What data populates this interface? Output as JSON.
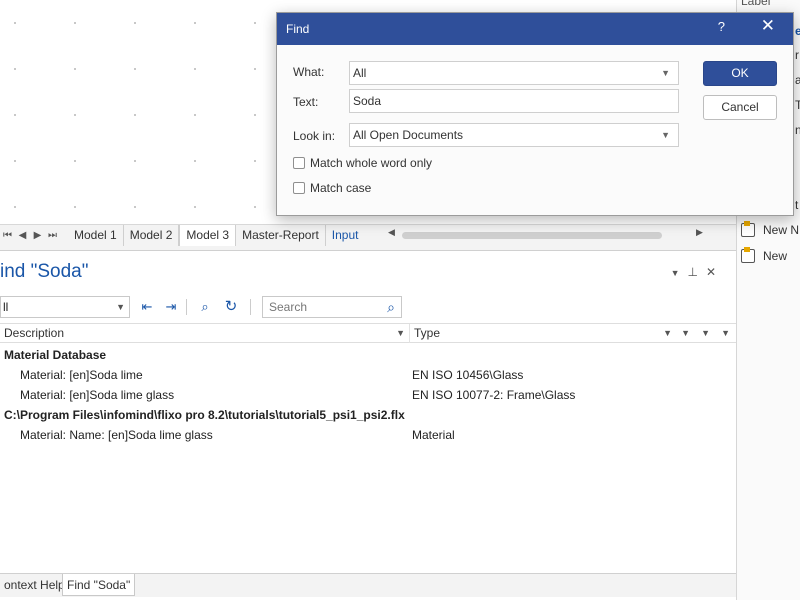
{
  "sheet_tabs": [
    "Model 1",
    "Model 2",
    "Model 3",
    "Master-Report",
    "Input"
  ],
  "right_pane": {
    "items": [
      "Label",
      "e",
      "r",
      "a",
      "Te",
      "n",
      "t",
      "New N",
      "New"
    ]
  },
  "find_panel": {
    "title": "ind \"Soda\"",
    "scope_value": "ll",
    "search_placeholder": "Search",
    "columns": {
      "description": "Description",
      "type": "Type"
    },
    "rows": [
      {
        "kind": "group",
        "desc": "Material Database",
        "type": ""
      },
      {
        "kind": "child",
        "desc": "Material: [en]Soda lime",
        "type": "EN ISO 10456\\Glass"
      },
      {
        "kind": "child",
        "desc": "Material: [en]Soda lime glass",
        "type": "EN ISO 10077-2: Frame\\Glass"
      },
      {
        "kind": "group",
        "desc": "C:\\Program Files\\infomind\\flixo pro 8.2\\tutorials\\tutorial5_psi1_psi2.flx",
        "type": ""
      },
      {
        "kind": "child",
        "desc": "Material: Name: [en]Soda lime glass",
        "type": "Material"
      }
    ],
    "bottom_tabs": [
      "ontext Help",
      "Find \"Soda\""
    ]
  },
  "dialog": {
    "title": "Find",
    "help": "?",
    "close": "✕",
    "what_label": "What:",
    "what_value": "All",
    "text_label": "Text:",
    "text_value": "Soda",
    "lookin_label": "Look in:",
    "lookin_value": "All Open Documents",
    "match_whole_word": "Match whole word only",
    "match_case": "Match case",
    "ok": "OK",
    "cancel": "Cancel"
  },
  "colors": {
    "accent": "#2f4f9a",
    "link": "#1a56a8"
  }
}
